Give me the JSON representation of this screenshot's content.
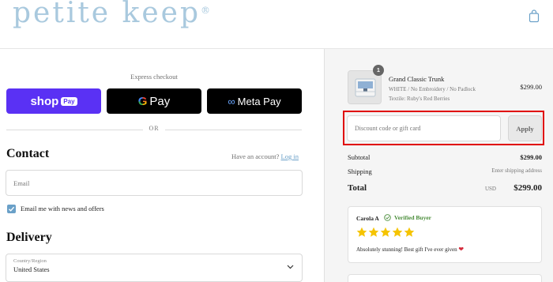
{
  "brand": {
    "logo_text": "petite keep",
    "trademark": "®"
  },
  "express": {
    "label": "Express checkout",
    "shop_pay": {
      "shop": "shop",
      "pay": "Pay"
    },
    "google_pay": {
      "g": "G",
      "pay": "Pay"
    },
    "meta_pay": {
      "symbol": "∞",
      "label": "Meta Pay"
    },
    "or": "OR"
  },
  "contact": {
    "title": "Contact",
    "account_prompt": "Have an account?",
    "login_link": "Log in",
    "email_placeholder": "Email",
    "newsletter_label": "Email me with news and offers",
    "newsletter_checked": true
  },
  "delivery": {
    "title": "Delivery",
    "country_label": "Country/Region",
    "country_value": "United States"
  },
  "order": {
    "item": {
      "quantity": "1",
      "name": "Grand Classic Trunk",
      "variant": "WHITE / No Embroidery / No Padlock",
      "textile": "Textile: Ruby's Red Berries",
      "price": "$299.00"
    },
    "discount_placeholder": "Discount code or gift card",
    "apply_label": "Apply",
    "subtotal_label": "Subtotal",
    "subtotal_value": "$299.00",
    "shipping_label": "Shipping",
    "shipping_value": "Enter shipping address",
    "total_label": "Total",
    "total_currency": "USD",
    "total_value": "$299.00"
  },
  "review": {
    "name": "Carola A",
    "badge": "Verified Buyer",
    "rating": 5,
    "text": "Absolutely stunning! Best gift I've ever given",
    "emoji": "❤"
  },
  "colors": {
    "accent": "#6aa0c8",
    "shop_pay": "#5a31f4",
    "highlight": "#e00000",
    "verified": "#4a8d3a",
    "star": "#f5c400"
  }
}
